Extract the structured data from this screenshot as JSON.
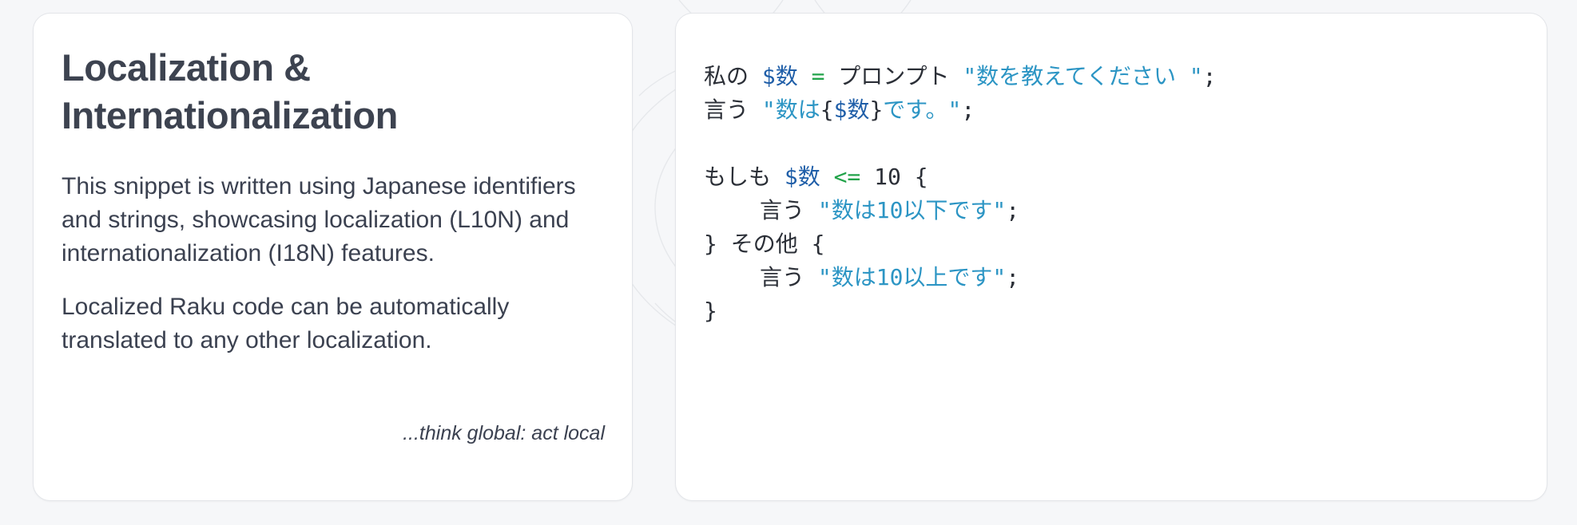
{
  "left_card": {
    "title": "Localization & Internationalization",
    "paragraph_1": "This snippet is written using Japanese identifiers and strings, showcasing localization (L10N) and internationalization (I18N) features.",
    "paragraph_2": "Localized Raku code can be automatically translated to any other localization.",
    "tagline": "...think global: act local"
  },
  "code": {
    "l1": {
      "kw": "私の ",
      "var": "$数",
      "op": " = ",
      "fn": "プロンプト ",
      "str": "\"数を教えてください \"",
      "end": ";"
    },
    "l2": {
      "kw": "言う ",
      "str_open": "\"数は",
      "brace_open": "{",
      "var": "$数",
      "brace_close": "}",
      "str_close": "です。\"",
      "end": ";"
    },
    "l4": {
      "kw": "もしも ",
      "var": "$数",
      "op": " <= ",
      "num": "10 {"
    },
    "l5": {
      "kw": "言う ",
      "str": "\"数は10以下です\"",
      "end": ";"
    },
    "l6": {
      "text": "} その他 {"
    },
    "l7": {
      "kw": "言う ",
      "str": "\"数は10以上です\"",
      "end": ";"
    },
    "l8": {
      "text": "}"
    }
  },
  "colors": {
    "variable": "#1f5ea8",
    "operator": "#22a34a",
    "string": "#2c95c4",
    "text": "#2b2f37",
    "background": "#f6f7f9"
  }
}
